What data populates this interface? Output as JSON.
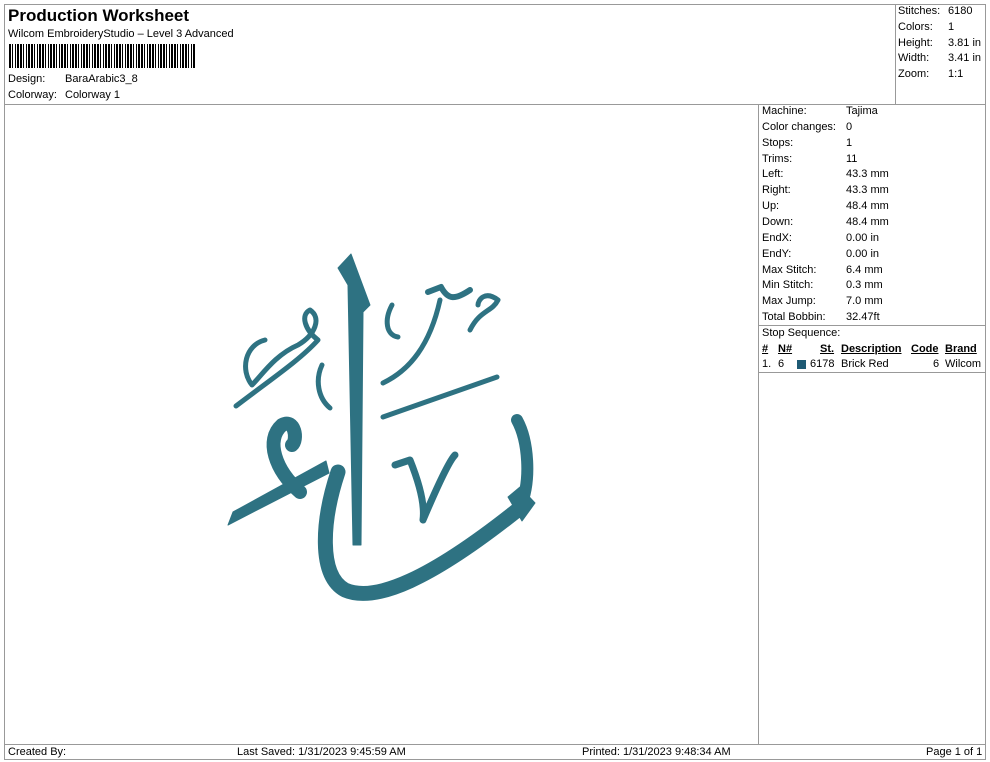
{
  "header": {
    "title": "Production Worksheet",
    "subtitle": "Wilcom EmbroideryStudio – Level 3 Advanced",
    "design_label": "Design:",
    "design_value": "BaraArabic3_8",
    "colorway_label": "Colorway:",
    "colorway_value": "Colorway 1"
  },
  "summary": [
    {
      "label": "Stitches:",
      "value": "6180"
    },
    {
      "label": "Colors:",
      "value": "1"
    },
    {
      "label": "Height:",
      "value": "3.81 in"
    },
    {
      "label": "Width:",
      "value": "3.41 in"
    },
    {
      "label": "Zoom:",
      "value": "1:1"
    }
  ],
  "details": [
    {
      "label": "Machine:",
      "value": "Tajima"
    },
    {
      "label": "Color changes:",
      "value": "0"
    },
    {
      "label": "Stops:",
      "value": "1"
    },
    {
      "label": "Trims:",
      "value": "11"
    },
    {
      "label": "Left:",
      "value": "43.3 mm"
    },
    {
      "label": "Right:",
      "value": "43.3 mm"
    },
    {
      "label": "Up:",
      "value": "48.4 mm"
    },
    {
      "label": "Down:",
      "value": "48.4 mm"
    },
    {
      "label": "EndX:",
      "value": "0.00 in"
    },
    {
      "label": "EndY:",
      "value": "0.00 in"
    },
    {
      "label": "Max Stitch:",
      "value": "6.4 mm"
    },
    {
      "label": "Min Stitch:",
      "value": "0.3 mm"
    },
    {
      "label": "Max Jump:",
      "value": "7.0 mm"
    },
    {
      "label": "Total Bobbin:",
      "value": "32.47ft"
    }
  ],
  "stop_sequence": {
    "label": "Stop Sequence:",
    "columns": [
      "#",
      "N#",
      "St.",
      "Description",
      "Code",
      "Brand"
    ],
    "rows": [
      {
        "num": "1.",
        "n": "6",
        "color": "#1e5a74",
        "stitches": "6178",
        "description": "Brick Red",
        "code": "6",
        "brand": "Wilcom"
      }
    ]
  },
  "design_color": "#2e7282",
  "footer": {
    "created_by": "Created By:",
    "last_saved": "Last Saved: 1/31/2023 9:45:59 AM",
    "printed": "Printed: 1/31/2023 9:48:34 AM",
    "page": "Page 1 of 1"
  }
}
